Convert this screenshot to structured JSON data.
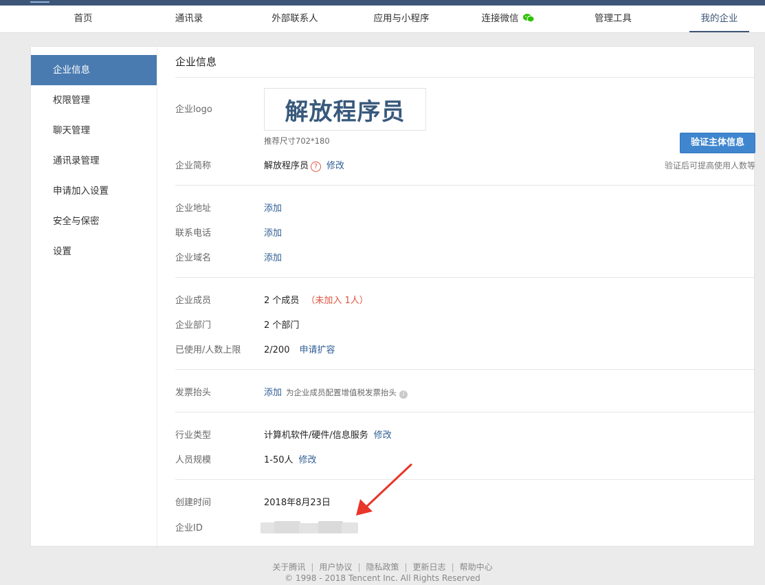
{
  "nav": {
    "items": [
      "首页",
      "通讯录",
      "外部联系人",
      "应用与小程序",
      "连接微信",
      "管理工具",
      "我的企业"
    ],
    "active": "我的企业"
  },
  "sidebar": {
    "items": [
      "企业信息",
      "权限管理",
      "聊天管理",
      "通讯录管理",
      "申请加入设置",
      "安全与保密",
      "设置"
    ]
  },
  "main": {
    "title": "企业信息",
    "logo": {
      "label": "企业logo",
      "text": "解放程序员",
      "hint": "推荐尺寸702*180"
    },
    "verify": {
      "button": "验证主体信息",
      "hint": "验证后可提高使用人数等"
    },
    "short_name": {
      "label": "企业简称",
      "value": "解放程序员",
      "help": "?",
      "action": "修改"
    },
    "address": {
      "label": "企业地址",
      "action": "添加"
    },
    "phone": {
      "label": "联系电话",
      "action": "添加"
    },
    "domain": {
      "label": "企业域名",
      "action": "添加"
    },
    "members": {
      "label": "企业成员",
      "value": "2 个成员",
      "warning": "（未加入 1人）"
    },
    "departments": {
      "label": "企业部门",
      "value": "2 个部门"
    },
    "usage": {
      "label": "已使用/人数上限",
      "value": "2/200",
      "action": "申请扩容"
    },
    "invoice": {
      "label": "发票抬头",
      "action": "添加",
      "hint": "为企业成员配置增值税发票抬头",
      "info": "i"
    },
    "industry": {
      "label": "行业类型",
      "value": "计算机软件/硬件/信息服务",
      "action": "修改"
    },
    "scale": {
      "label": "人员规模",
      "value": "1-50人",
      "action": "修改"
    },
    "created": {
      "label": "创建时间",
      "value": "2018年8月23日"
    },
    "corp_id": {
      "label": "企业ID"
    }
  },
  "footer": {
    "links": [
      "关于腾讯",
      "用户协议",
      "隐私政策",
      "更新日志",
      "帮助中心"
    ],
    "copyright": "© 1998 - 2018 Tencent Inc. All Rights Reserved"
  },
  "colors": {
    "brand": "#3d5576",
    "sidebar_active": "#4a7bb0",
    "link": "#2d5d93",
    "button": "#3f86cf",
    "warning": "#e0533c",
    "annotation_arrow": "#e8362a"
  }
}
